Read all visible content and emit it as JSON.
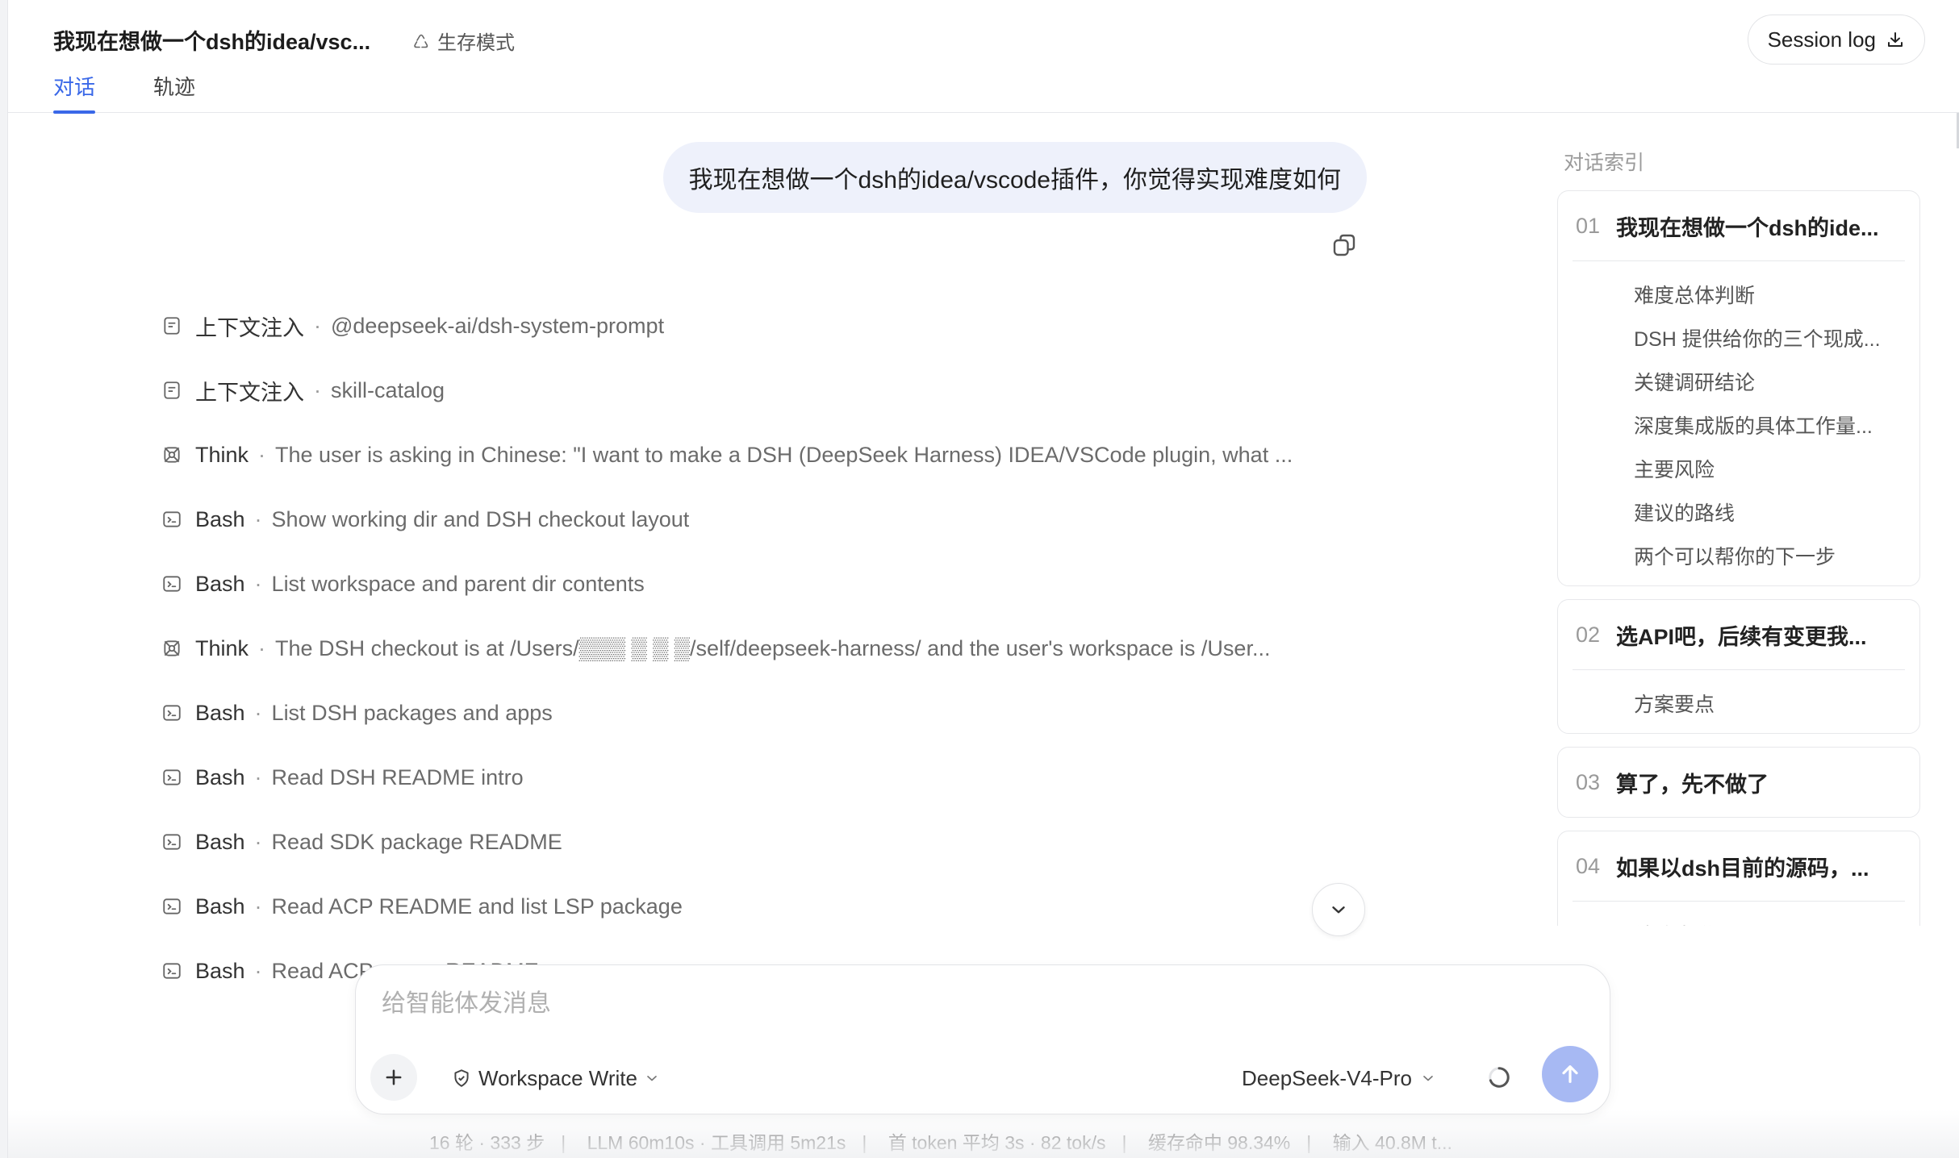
{
  "header": {
    "title": "我现在想做一个dsh的idea/vsc...",
    "mode_label": "生存模式",
    "session_log_label": "Session log",
    "tabs": [
      {
        "label": "对话",
        "active": true
      },
      {
        "label": "轨迹",
        "active": false
      }
    ]
  },
  "chat": {
    "user_message": "我现在想做一个dsh的idea/vscode插件，你觉得实现难度如何",
    "steps": [
      {
        "kind": "上下文注入",
        "desc": "@deepseek-ai/dsh-system-prompt",
        "icon": "doc-icon"
      },
      {
        "kind": "上下文注入",
        "desc": "skill-catalog",
        "icon": "doc-icon"
      },
      {
        "kind": "Think",
        "desc": "The user is asking in Chinese: \"I want to make a DSH (DeepSeek Harness) IDEA/VSCode plugin, what ...",
        "icon": "think-icon"
      },
      {
        "kind": "Bash",
        "desc": "Show working dir and DSH checkout layout",
        "icon": "terminal-icon"
      },
      {
        "kind": "Bash",
        "desc": "List workspace and parent dir contents",
        "icon": "terminal-icon"
      },
      {
        "kind": "Think",
        "desc": "The DSH checkout is at /Users/▒▒▒ ▒ ▒ ▒/self/deepseek-harness/ and the user's workspace is /User...",
        "icon": "think-icon"
      },
      {
        "kind": "Bash",
        "desc": "List DSH packages and apps",
        "icon": "terminal-icon"
      },
      {
        "kind": "Bash",
        "desc": "Read DSH README intro",
        "icon": "terminal-icon"
      },
      {
        "kind": "Bash",
        "desc": "Read SDK package README",
        "icon": "terminal-icon"
      },
      {
        "kind": "Bash",
        "desc": "Read ACP README and list LSP package",
        "icon": "terminal-icon"
      },
      {
        "kind": "Bash",
        "desc": "Read ACP server README",
        "icon": "terminal-icon"
      }
    ]
  },
  "index": {
    "heading": "对话索引",
    "cards": [
      {
        "num": "01",
        "title": "我现在想做一个dsh的ide...",
        "items": [
          "难度总体判断",
          "DSH 提供给你的三个现成...",
          "关键调研结论",
          "深度集成版的具体工作量...",
          "主要风险",
          "建议的路线",
          "两个可以帮你的下一步"
        ]
      },
      {
        "num": "02",
        "title": "选API吧，后续有变更我...",
        "items": [
          "方案要点"
        ]
      },
      {
        "num": "03",
        "title": "算了，先不做了",
        "items": []
      },
      {
        "num": "04",
        "title": "如果以dsh目前的源码，...",
        "items": [
          "结论先说"
        ]
      }
    ]
  },
  "composer": {
    "placeholder": "给智能体发消息",
    "workspace_label": "Workspace Write",
    "model_label": "DeepSeek-V4-Pro"
  },
  "stats": {
    "rounds": "16 轮 · 333 步",
    "llm": "LLM 60m10s · 工具调用 5m21s",
    "first_token": "首 token 平均 3s · 82 tok/s",
    "cache": "缓存命中 98.34%",
    "input": "输入 40.8M t..."
  },
  "colors": {
    "accent": "#3a68e8",
    "user_bubble": "#eef1fb",
    "send_button": "#a7b9f3"
  }
}
